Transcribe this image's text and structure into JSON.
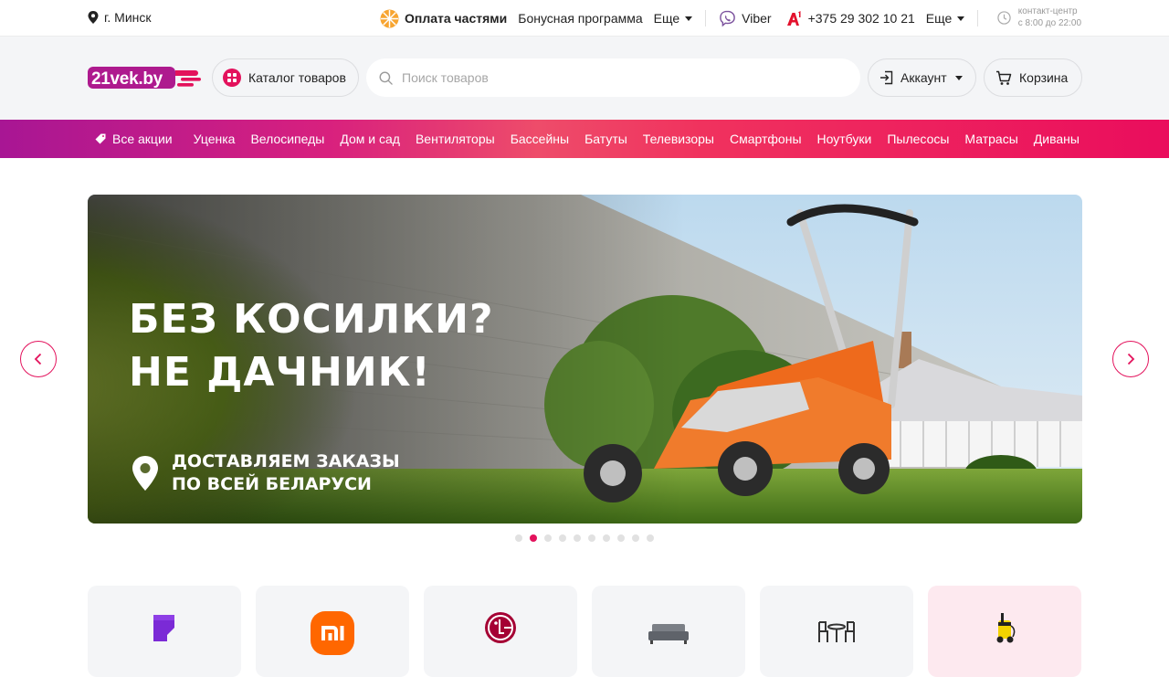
{
  "topbar": {
    "city": "г. Минск",
    "links": [
      {
        "label": "Оплата частями",
        "icon": "orange-slice-icon"
      },
      {
        "label": "Бонусная программа"
      },
      {
        "label": "Еще"
      }
    ],
    "viber": "Viber",
    "phone": "+375 29 302 10 21",
    "more": "Еще",
    "hours_title": "контакт-центр",
    "hours": "с 8:00 до 22:00"
  },
  "header": {
    "logo": "21vek.by",
    "catalog": "Каталог товаров",
    "search_placeholder": "Поиск товаров",
    "account": "Аккаунт",
    "cart": "Корзина"
  },
  "promo": {
    "all": "Все акции",
    "items": [
      "Уценка",
      "Велосипеды",
      "Дом и сад",
      "Вентиляторы",
      "Бассейны",
      "Батуты",
      "Телевизоры",
      "Смартфоны",
      "Ноутбуки",
      "Пылесосы",
      "Матрасы",
      "Диваны"
    ]
  },
  "banner": {
    "line1": "БЕЗ КОСИЛКИ?",
    "line2": "НЕ ДАЧНИК!",
    "sub1": "ДОСТАВЛЯЕМ ЗАКАЗЫ",
    "sub2": "ПО ВСЕЙ БЕЛАРУСИ"
  },
  "carousel": {
    "total": 10,
    "active": 2
  },
  "colors": {
    "brand": "#e3125c",
    "logo_bg": "#ae1a8e"
  }
}
